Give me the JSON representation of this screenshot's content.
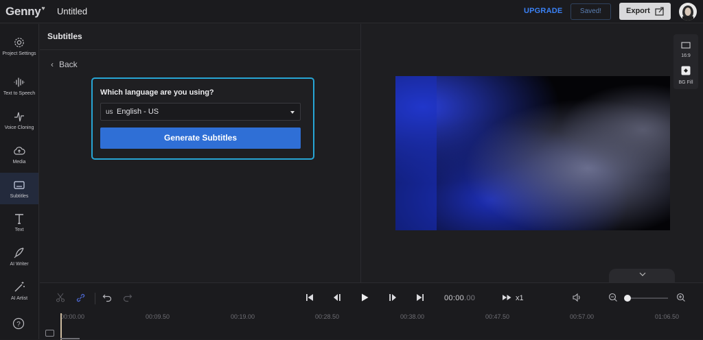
{
  "app": {
    "logo": "Genny",
    "project_title": "Untitled"
  },
  "topbar": {
    "upgrade_label": "UPGRADE",
    "saved_label": "Saved!",
    "export_label": "Export"
  },
  "sidebar": {
    "items": [
      {
        "label": "Project Settings",
        "icon": "gear-icon"
      },
      {
        "label": "Text to Speech",
        "icon": "waveform-icon"
      },
      {
        "label": "Voice Cloning",
        "icon": "voice-clone-icon"
      },
      {
        "label": "Media",
        "icon": "cloud-upload-icon"
      },
      {
        "label": "Subtitles",
        "icon": "subtitles-icon",
        "active": true
      },
      {
        "label": "Text",
        "icon": "text-t-icon"
      },
      {
        "label": "AI Writer",
        "icon": "quill-icon"
      },
      {
        "label": "AI Artist",
        "icon": "magic-wand-icon"
      }
    ],
    "help_icon": "help-icon"
  },
  "subtitles_panel": {
    "title": "Subtitles",
    "back_label": "Back",
    "question": "Which language are you using?",
    "language_code": "us",
    "language_name": "English - US",
    "generate_label": "Generate Subtitles"
  },
  "preview_tools": {
    "aspect_label": "16:9",
    "bg_fill_label": "BG Fill"
  },
  "playback": {
    "timecode_main": "00:00",
    "timecode_frac": ".00",
    "speed": "x1"
  },
  "ruler": {
    "labels": [
      "00:00.00",
      "00:09.50",
      "00:19.00",
      "00:28.50",
      "00:38.00",
      "00:47.50",
      "00:57.00",
      "01:06.50"
    ]
  },
  "colors": {
    "accent": "#2f6fd6",
    "highlight_border": "#27a6d6",
    "upgrade": "#3b82f6"
  }
}
